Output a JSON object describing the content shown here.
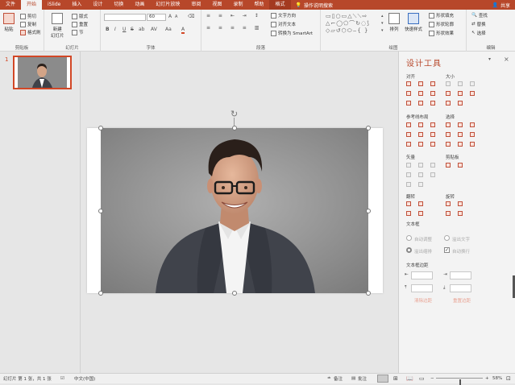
{
  "tabs": [
    "文件",
    "开始",
    "iSlide",
    "插入",
    "设计",
    "切换",
    "动画",
    "幻灯片放映",
    "审阅",
    "视图",
    "录制",
    "帮助",
    "格式"
  ],
  "active_tab": "开始",
  "tell_me": "操作说明搜索",
  "share": "共享",
  "ribbon": {
    "clipboard": {
      "paste": "粘贴",
      "cut": "剪切",
      "copy": "复制",
      "format_painter": "格式刷",
      "label": "剪贴板"
    },
    "slides": {
      "new_slide": "新建\n幻灯片",
      "layout": "版式",
      "reset": "重置",
      "section": "节",
      "label": "幻灯片"
    },
    "font": {
      "font_name": "",
      "font_size": "60",
      "label": "字体",
      "bold": "B",
      "italic": "I",
      "underline": "U",
      "strike": "S",
      "shadow": "ab",
      "spacing": "AV",
      "case": "Aa",
      "color": "A",
      "grow": "A",
      "shrink": "A"
    },
    "paragraph": {
      "text_direction": "文字方向",
      "align_text": "对齐文本",
      "smartart": "转换为 SmartArt",
      "label": "段落"
    },
    "drawing": {
      "arrange": "排列",
      "quick_styles": "快速样式",
      "fill": "形状填充",
      "outline": "形状轮廓",
      "effects": "形状效果",
      "label": "绘图"
    },
    "editing": {
      "find": "查找",
      "replace": "替换",
      "select": "选择",
      "label": "编辑"
    }
  },
  "slide_number": "1",
  "pane": {
    "title": "设计工具",
    "align": "对齐",
    "size": "大小",
    "guides": "参考线布局",
    "select": "选择",
    "vector": "矢量",
    "clipboard": "剪贴板",
    "flip": "翻转",
    "rotate": "旋转",
    "textbox": "文本框",
    "autofit": "自动调整",
    "overflow": "溢出文字",
    "shrink": "溢出缩排",
    "wrap": "自动换行",
    "margins": "文本框边距",
    "reset_margin": "清除边距",
    "restore_margin": "重置边距"
  },
  "status": {
    "slide_info": "幻灯片 第 1 张，共 1 张",
    "language": "中文(中国)",
    "notes": "备注",
    "comments": "批注",
    "zoom": "58%",
    "zoom_value": 0.58
  },
  "colors": {
    "accent": "#b7472a",
    "selection": "#d24726"
  }
}
